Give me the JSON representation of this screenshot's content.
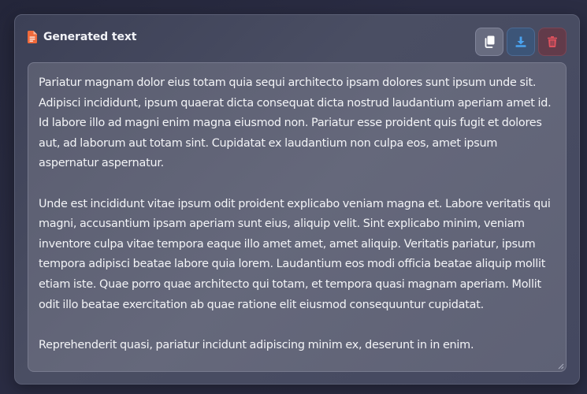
{
  "panel": {
    "title": "Generated text",
    "icons": {
      "title": "file-text-icon",
      "copy": "copy-icon",
      "download": "download-icon",
      "delete": "trash-icon"
    },
    "colors": {
      "file_icon": "#f06a3b",
      "copy_icon": "#ffffff",
      "download_icon": "#4aa3f0",
      "delete_icon": "#e0525e"
    }
  },
  "textarea": {
    "paragraphs": [
      "Pariatur magnam dolor eius totam quia sequi architecto ipsam dolores sunt ipsum unde sit. Adipisci incididunt, ipsum quaerat dicta consequat dicta nostrud laudantium aperiam amet id. Id labore illo ad magni enim magna eiusmod non. Pariatur esse proident quis fugit et dolores aut, ad laborum aut totam sint. Cupidatat ex laudantium non culpa eos, amet ipsum aspernatur aspernatur.",
      "Unde est incididunt vitae ipsum odit proident explicabo veniam magna et. Labore veritatis qui magni, accusantium ipsam aperiam sunt eius, aliquip velit. Sint explicabo minim, veniam inventore culpa vitae tempora eaque illo amet amet, amet aliquip. Veritatis pariatur, ipsum tempora adipisci beatae labore quia lorem. Laudantium eos modi officia beatae aliquip mollit etiam iste. Quae porro quae architecto qui totam, et tempora quasi magnam aperiam. Mollit odit illo beatae exercitation ab quae ratione elit eiusmod consequuntur cupidatat.",
      "Reprehenderit quasi, pariatur incidunt adipiscing minim ex, deserunt in in enim."
    ]
  }
}
